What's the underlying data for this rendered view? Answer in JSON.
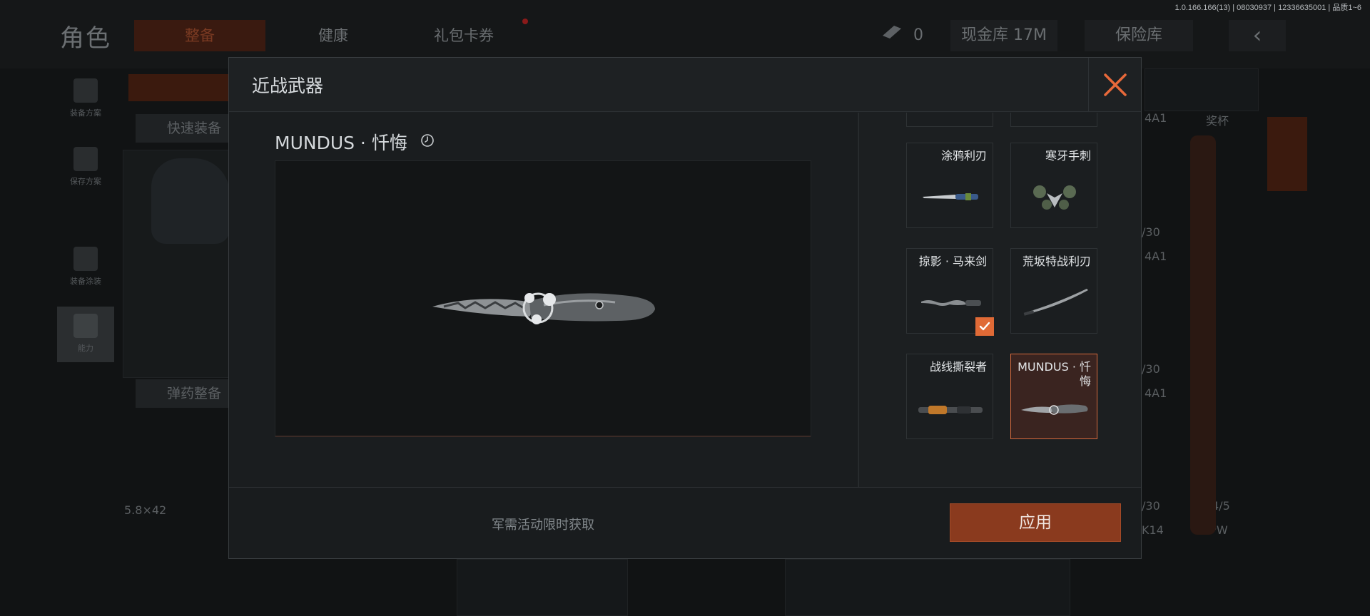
{
  "version_info": "1.0.166.166(13) | 08030937 | 12336635001 | 品质1~6",
  "background": {
    "page_title": "角色",
    "tabs": [
      {
        "label": "整备",
        "active": true
      },
      {
        "label": "健康",
        "active": false
      },
      {
        "label": "礼包卡券",
        "active": false
      }
    ],
    "currency_count": "0",
    "cash_vault": "现金库 17M",
    "insurance": "保险库",
    "sidebar": [
      {
        "label": "装备方案"
      },
      {
        "label": "保存方案"
      },
      {
        "label": "装备涂装"
      },
      {
        "label": "能力"
      }
    ],
    "quick_equip": "快速装备",
    "ammo_equip": "弹药整备",
    "ammo_type": "5.8×42",
    "side_texts": [
      "4A1",
      "奖杯",
      "/30",
      "4A1",
      "/30",
      "4A1",
      "/30",
      "4/5",
      "K14",
      "CPW"
    ]
  },
  "modal": {
    "title": "近战武器",
    "weapon_name": "MUNDUS · 忏悔",
    "items": [
      {
        "label": "涂鸦利刃",
        "selected": false,
        "equipped": false
      },
      {
        "label": "寒牙手刺",
        "selected": false,
        "equipped": false
      },
      {
        "label": "掠影 · 马来剑",
        "selected": false,
        "equipped": true
      },
      {
        "label": "荒坂特战利刃",
        "selected": false,
        "equipped": false
      },
      {
        "label": "战线撕裂者",
        "selected": false,
        "equipped": false
      },
      {
        "label": "MUNDUS · 忏悔",
        "selected": true,
        "equipped": false
      }
    ],
    "footer_note": "军需活动限时获取",
    "apply_label": "应用",
    "accent_color": "#e06a36"
  }
}
